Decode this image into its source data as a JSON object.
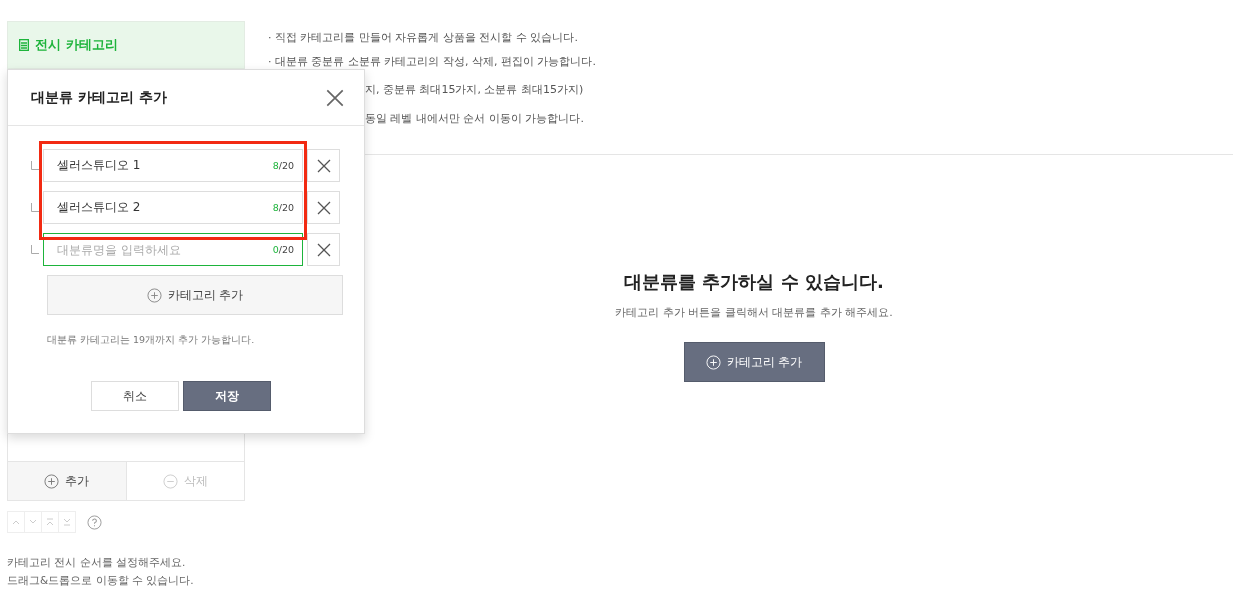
{
  "sidebar": {
    "title": "전시 카테고리",
    "actions": [
      {
        "label": "추가",
        "disabled": false
      },
      {
        "label": "삭제",
        "disabled": true
      }
    ],
    "order_buttons": [
      {
        "kind": "up",
        "disabled": true
      },
      {
        "kind": "down",
        "disabled": true
      },
      {
        "kind": "top",
        "disabled": true
      },
      {
        "kind": "bottom",
        "disabled": true
      }
    ],
    "help_lines": [
      "카테고리 전시 순서를 설정해주세요.",
      "드래그&드롭으로 이동할 수 있습니다."
    ]
  },
  "notes": [
    "· 직접 카테고리를 만들어 자유롭게 상품을 전시할 수 있습니다.",
    "· 대분류 중분류 소분류 카테고리의 작성, 삭제, 편집이 가능합니다."
  ],
  "notes_behind_dialog": [
    "지, 중분류 최대15가지, 소분류 최대15가지)",
    "동일 레벨 내에서만 순서 이동이 가능합니다."
  ],
  "empty_state": {
    "title": "대분류를 추가하실 수 있습니다.",
    "subtitle": "카테고리 추가 버튼을 클릭해서 대분류를 추가 해주세요.",
    "button": "카테고리 추가"
  },
  "dialog": {
    "title": "대분류 카테고리 추가",
    "rows": [
      {
        "value": "셀러스튜디오 1",
        "count": "8",
        "limit": "/20",
        "focused": false,
        "highlighted": true
      },
      {
        "value": "셀러스튜디오 2",
        "count": "8",
        "limit": "/20",
        "focused": false,
        "highlighted": true
      },
      {
        "placeholder": "대분류명을 입력하세요",
        "count": "0",
        "limit": "/20",
        "focused": true,
        "highlighted": false
      }
    ],
    "add_button": "카테고리 추가",
    "note": "대분류 카테고리는 19개까지 추가 가능합니다.",
    "buttons": [
      {
        "label": "취소",
        "kind": "secondary"
      },
      {
        "label": "저장",
        "kind": "primary"
      }
    ]
  }
}
